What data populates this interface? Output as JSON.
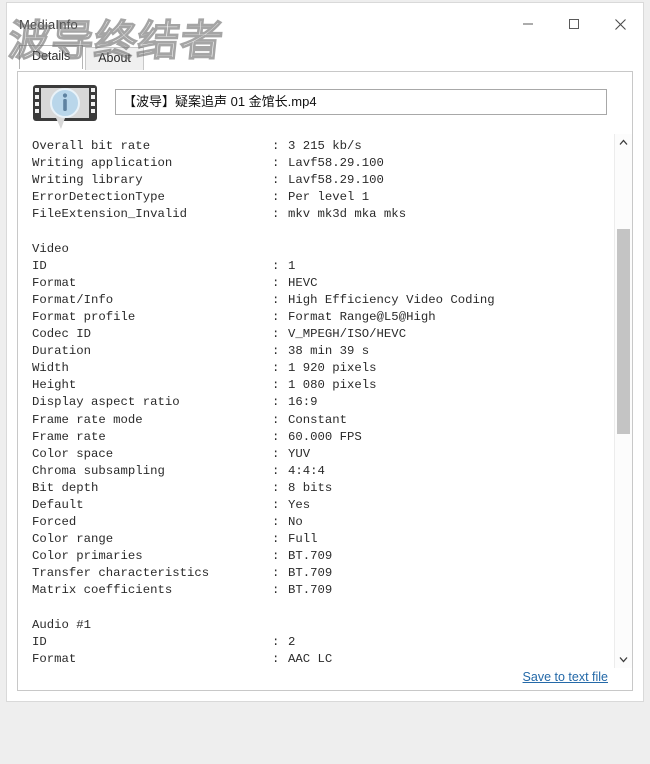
{
  "window": {
    "title": "MediaInfo",
    "controls": {
      "minimize": "minimize-icon",
      "maximize": "maximize-icon",
      "close": "close-icon"
    }
  },
  "watermark": {
    "text": "波导终结者"
  },
  "tabs": [
    {
      "label": "Details",
      "active": true
    },
    {
      "label": "About",
      "active": false
    }
  ],
  "file": {
    "icon": "mediainfo-film-info-icon",
    "name": "【波导】疑案追声 01 金馆长.mp4"
  },
  "scrollbar": {
    "up_icon": "chevron-up-icon",
    "down_icon": "chevron-down-icon"
  },
  "footer": {
    "save_link": "Save to text file"
  },
  "info": {
    "lines": [
      {
        "type": "pair",
        "key": "Overall bit rate",
        "value": "3 215 kb/s"
      },
      {
        "type": "pair",
        "key": "Writing application",
        "value": "Lavf58.29.100"
      },
      {
        "type": "pair",
        "key": "Writing library",
        "value": "Lavf58.29.100"
      },
      {
        "type": "pair",
        "key": "ErrorDetectionType",
        "value": "Per level 1"
      },
      {
        "type": "pair",
        "key": "FileExtension_Invalid",
        "value": "mkv mk3d mka mks"
      },
      {
        "type": "blank"
      },
      {
        "type": "section",
        "key": "Video"
      },
      {
        "type": "pair",
        "key": "ID",
        "value": "1"
      },
      {
        "type": "pair",
        "key": "Format",
        "value": "HEVC"
      },
      {
        "type": "pair",
        "key": "Format/Info",
        "value": "High Efficiency Video Coding"
      },
      {
        "type": "pair",
        "key": "Format profile",
        "value": "Format Range@L5@High"
      },
      {
        "type": "pair",
        "key": "Codec ID",
        "value": "V_MPEGH/ISO/HEVC"
      },
      {
        "type": "pair",
        "key": "Duration",
        "value": "38 min 39 s"
      },
      {
        "type": "pair",
        "key": "Width",
        "value": "1 920 pixels"
      },
      {
        "type": "pair",
        "key": "Height",
        "value": "1 080 pixels"
      },
      {
        "type": "pair",
        "key": "Display aspect ratio",
        "value": "16:9"
      },
      {
        "type": "pair",
        "key": "Frame rate mode",
        "value": "Constant"
      },
      {
        "type": "pair",
        "key": "Frame rate",
        "value": "60.000 FPS"
      },
      {
        "type": "pair",
        "key": "Color space",
        "value": "YUV"
      },
      {
        "type": "pair",
        "key": "Chroma subsampling",
        "value": "4:4:4"
      },
      {
        "type": "pair",
        "key": "Bit depth",
        "value": "8 bits"
      },
      {
        "type": "pair",
        "key": "Default",
        "value": "Yes"
      },
      {
        "type": "pair",
        "key": "Forced",
        "value": "No"
      },
      {
        "type": "pair",
        "key": "Color range",
        "value": "Full"
      },
      {
        "type": "pair",
        "key": "Color primaries",
        "value": "BT.709"
      },
      {
        "type": "pair",
        "key": "Transfer characteristics",
        "value": "BT.709"
      },
      {
        "type": "pair",
        "key": "Matrix coefficients",
        "value": "BT.709"
      },
      {
        "type": "blank"
      },
      {
        "type": "section",
        "key": "Audio #1"
      },
      {
        "type": "pair",
        "key": "ID",
        "value": "2"
      },
      {
        "type": "pair",
        "key": "Format",
        "value": "AAC LC"
      }
    ]
  },
  "colors": {
    "link": "#2469a8",
    "text": "#2a2a2a",
    "window_bg": "#ffffff",
    "page_bg": "#eeeeee",
    "scroll_thumb": "#c4c4c4"
  }
}
